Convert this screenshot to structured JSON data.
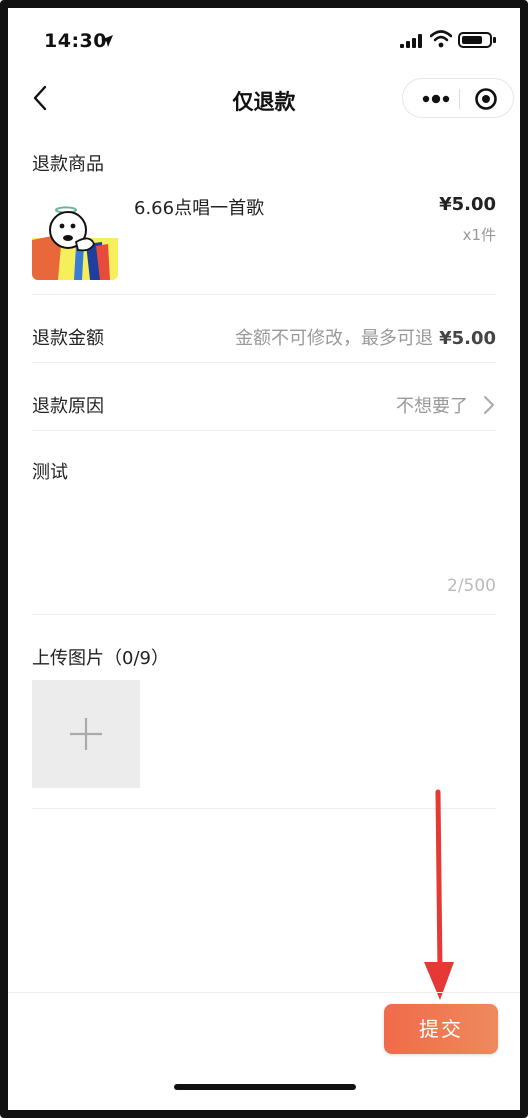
{
  "status_bar": {
    "time": "14:30"
  },
  "nav": {
    "title": "仅退款",
    "more_icon": "more-dots-icon",
    "close_icon": "target-circle-icon",
    "back_icon": "chevron-left-icon"
  },
  "refund_goods": {
    "section_label": "退款商品",
    "product": {
      "name": "6.66点唱一首歌",
      "price": "¥5.00",
      "quantity": "x1件"
    }
  },
  "refund_amount": {
    "label": "退款金额",
    "hint": "金额不可修改，最多可退",
    "max_amount": "¥5.00"
  },
  "refund_reason": {
    "label": "退款原因",
    "value": "不想要了"
  },
  "description": {
    "text": "测试",
    "counter": "2/500"
  },
  "upload": {
    "label": "上传图片（0/9）"
  },
  "submit": {
    "label": "提交"
  },
  "colors": {
    "accent": "#f0714f",
    "annotation_arrow": "#e53935"
  }
}
